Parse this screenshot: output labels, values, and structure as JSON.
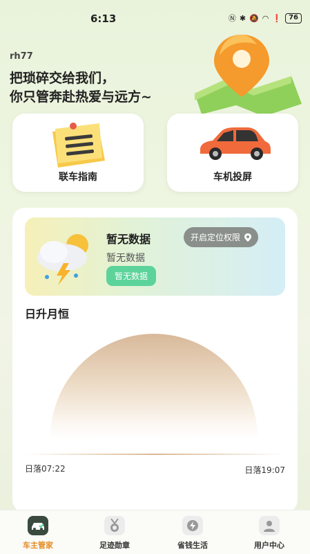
{
  "status_bar": {
    "time": "6:13",
    "battery": "76"
  },
  "header": {
    "username": "rh77",
    "slogan_line1": "把琐碎交给我们，",
    "slogan_line2": "你只管奔赴热爱与远方~"
  },
  "quick_cards": [
    {
      "label": "联车指南",
      "icon": "note-icon"
    },
    {
      "label": "车机投屏",
      "icon": "car-icon"
    }
  ],
  "weather": {
    "title": "暂无数据",
    "subtitle": "暂无数据",
    "badge": "暂无数据",
    "location_button": "开启定位权限"
  },
  "sun": {
    "title": "日升月恒",
    "sunrise": "日落07:22",
    "sunset": "日落19:07"
  },
  "tabs": [
    {
      "label": "车主管家",
      "icon": "car-home-icon",
      "active": true
    },
    {
      "label": "足迹勋章",
      "icon": "medal-icon",
      "active": false
    },
    {
      "label": "省钱生活",
      "icon": "savings-icon",
      "active": false
    },
    {
      "label": "用户中心",
      "icon": "user-icon",
      "active": false
    }
  ],
  "colors": {
    "accent": "#e38b23",
    "green": "#5cd39a"
  }
}
